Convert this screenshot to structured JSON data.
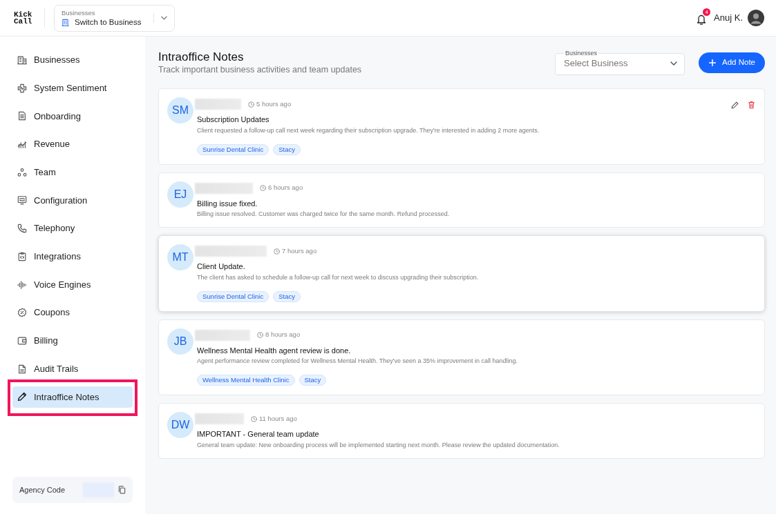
{
  "header": {
    "logo": "Kick Call",
    "business_switcher": {
      "label": "Businesses",
      "value": "Switch to Business"
    },
    "notification_count": "4",
    "user_name": "Anuj K."
  },
  "sidebar": {
    "items": [
      {
        "label": "Businesses",
        "selected": false,
        "outlined": false
      },
      {
        "label": "System Sentiment",
        "selected": false,
        "outlined": false
      },
      {
        "label": "Onboarding",
        "selected": false,
        "outlined": false
      },
      {
        "label": "Revenue",
        "selected": false,
        "outlined": false
      },
      {
        "label": "Team",
        "selected": false,
        "outlined": false
      },
      {
        "label": "Configuration",
        "selected": false,
        "outlined": false
      },
      {
        "label": "Telephony",
        "selected": false,
        "outlined": false
      },
      {
        "label": "Integrations",
        "selected": false,
        "outlined": false
      },
      {
        "label": "Voice Engines",
        "selected": false,
        "outlined": false
      },
      {
        "label": "Coupons",
        "selected": false,
        "outlined": false
      },
      {
        "label": "Billing",
        "selected": false,
        "outlined": false
      },
      {
        "label": "Audit Trails",
        "selected": false,
        "outlined": false
      },
      {
        "label": "Intraoffice Notes",
        "selected": true,
        "outlined": true
      }
    ],
    "agency_code": {
      "label": "Agency Code"
    }
  },
  "page": {
    "title": "Intraoffice Notes",
    "subtitle": "Track important business activities and team updates",
    "business_filter": {
      "label": "Businesses",
      "placeholder": "Select Business"
    },
    "add_button": {
      "label": "Add Note"
    }
  },
  "notes": [
    {
      "initials": "SM",
      "time": "5 hours ago",
      "title": "Subscription Updates",
      "body": "Client requested a follow-up call next week regarding their subscription upgrade. They're interested in adding 2 more agents.",
      "tags": [
        "Sunrise Dental Clinic",
        "Stacy"
      ],
      "actions_visible": true,
      "hovered": false
    },
    {
      "initials": "EJ",
      "time": "6 hours ago",
      "title": "Billing issue fixed.",
      "body": "Billing issue resolved. Customer was charged twice for the same month. Refund processed.",
      "actions_visible": false,
      "hovered": false
    },
    {
      "initials": "MT",
      "time": "7 hours ago",
      "title": "Client Update.",
      "body": "The client has asked to schedule a follow-up call for next week to discuss upgrading their subscription.",
      "tags": [
        "Sunrise Dental Clinic",
        "Stacy"
      ],
      "actions_visible": false,
      "hovered": true
    },
    {
      "initials": "JB",
      "time": "8 hours ago",
      "title": "Wellness Mental Health agent review is done.",
      "body": "Agent performance review completed for Wellness Mental Health. They've seen a 35% improvement in call handling.",
      "tags": [
        "Wellness Mental Health Clinic",
        "Stacy"
      ],
      "actions_visible": false,
      "hovered": false
    },
    {
      "initials": "DW",
      "time": "11 hours ago",
      "title": "IMPORTANT - General team update",
      "body": "General team update: New onboarding process will be implemented starting next month. Please review the updated documentation.",
      "actions_visible": false,
      "hovered": false
    }
  ]
}
